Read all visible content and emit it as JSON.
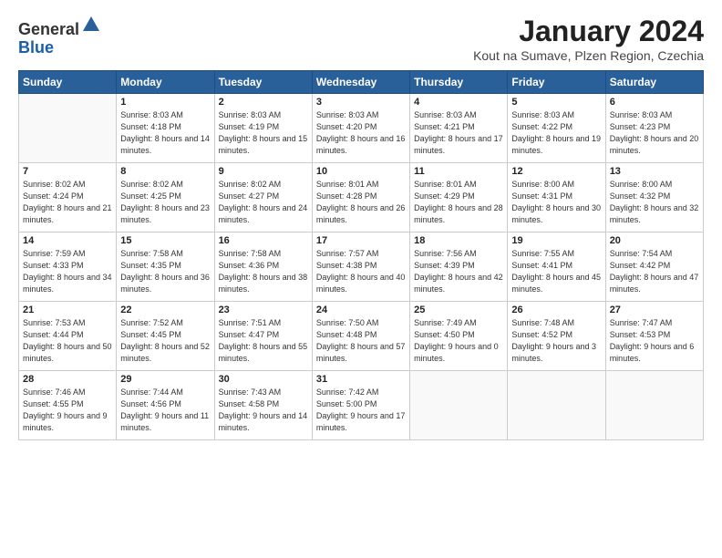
{
  "logo": {
    "general": "General",
    "blue": "Blue"
  },
  "title": "January 2024",
  "subtitle": "Kout na Sumave, Plzen Region, Czechia",
  "days_of_week": [
    "Sunday",
    "Monday",
    "Tuesday",
    "Wednesday",
    "Thursday",
    "Friday",
    "Saturday"
  ],
  "weeks": [
    [
      {
        "day": "",
        "empty": true
      },
      {
        "day": "1",
        "sunrise": "8:03 AM",
        "sunset": "4:18 PM",
        "daylight": "8 hours and 14 minutes."
      },
      {
        "day": "2",
        "sunrise": "8:03 AM",
        "sunset": "4:19 PM",
        "daylight": "8 hours and 15 minutes."
      },
      {
        "day": "3",
        "sunrise": "8:03 AM",
        "sunset": "4:20 PM",
        "daylight": "8 hours and 16 minutes."
      },
      {
        "day": "4",
        "sunrise": "8:03 AM",
        "sunset": "4:21 PM",
        "daylight": "8 hours and 17 minutes."
      },
      {
        "day": "5",
        "sunrise": "8:03 AM",
        "sunset": "4:22 PM",
        "daylight": "8 hours and 19 minutes."
      },
      {
        "day": "6",
        "sunrise": "8:03 AM",
        "sunset": "4:23 PM",
        "daylight": "8 hours and 20 minutes."
      }
    ],
    [
      {
        "day": "7",
        "sunrise": "8:02 AM",
        "sunset": "4:24 PM",
        "daylight": "8 hours and 21 minutes."
      },
      {
        "day": "8",
        "sunrise": "8:02 AM",
        "sunset": "4:25 PM",
        "daylight": "8 hours and 23 minutes."
      },
      {
        "day": "9",
        "sunrise": "8:02 AM",
        "sunset": "4:27 PM",
        "daylight": "8 hours and 24 minutes."
      },
      {
        "day": "10",
        "sunrise": "8:01 AM",
        "sunset": "4:28 PM",
        "daylight": "8 hours and 26 minutes."
      },
      {
        "day": "11",
        "sunrise": "8:01 AM",
        "sunset": "4:29 PM",
        "daylight": "8 hours and 28 minutes."
      },
      {
        "day": "12",
        "sunrise": "8:00 AM",
        "sunset": "4:31 PM",
        "daylight": "8 hours and 30 minutes."
      },
      {
        "day": "13",
        "sunrise": "8:00 AM",
        "sunset": "4:32 PM",
        "daylight": "8 hours and 32 minutes."
      }
    ],
    [
      {
        "day": "14",
        "sunrise": "7:59 AM",
        "sunset": "4:33 PM",
        "daylight": "8 hours and 34 minutes."
      },
      {
        "day": "15",
        "sunrise": "7:58 AM",
        "sunset": "4:35 PM",
        "daylight": "8 hours and 36 minutes."
      },
      {
        "day": "16",
        "sunrise": "7:58 AM",
        "sunset": "4:36 PM",
        "daylight": "8 hours and 38 minutes."
      },
      {
        "day": "17",
        "sunrise": "7:57 AM",
        "sunset": "4:38 PM",
        "daylight": "8 hours and 40 minutes."
      },
      {
        "day": "18",
        "sunrise": "7:56 AM",
        "sunset": "4:39 PM",
        "daylight": "8 hours and 42 minutes."
      },
      {
        "day": "19",
        "sunrise": "7:55 AM",
        "sunset": "4:41 PM",
        "daylight": "8 hours and 45 minutes."
      },
      {
        "day": "20",
        "sunrise": "7:54 AM",
        "sunset": "4:42 PM",
        "daylight": "8 hours and 47 minutes."
      }
    ],
    [
      {
        "day": "21",
        "sunrise": "7:53 AM",
        "sunset": "4:44 PM",
        "daylight": "8 hours and 50 minutes."
      },
      {
        "day": "22",
        "sunrise": "7:52 AM",
        "sunset": "4:45 PM",
        "daylight": "8 hours and 52 minutes."
      },
      {
        "day": "23",
        "sunrise": "7:51 AM",
        "sunset": "4:47 PM",
        "daylight": "8 hours and 55 minutes."
      },
      {
        "day": "24",
        "sunrise": "7:50 AM",
        "sunset": "4:48 PM",
        "daylight": "8 hours and 57 minutes."
      },
      {
        "day": "25",
        "sunrise": "7:49 AM",
        "sunset": "4:50 PM",
        "daylight": "9 hours and 0 minutes."
      },
      {
        "day": "26",
        "sunrise": "7:48 AM",
        "sunset": "4:52 PM",
        "daylight": "9 hours and 3 minutes."
      },
      {
        "day": "27",
        "sunrise": "7:47 AM",
        "sunset": "4:53 PM",
        "daylight": "9 hours and 6 minutes."
      }
    ],
    [
      {
        "day": "28",
        "sunrise": "7:46 AM",
        "sunset": "4:55 PM",
        "daylight": "9 hours and 9 minutes."
      },
      {
        "day": "29",
        "sunrise": "7:44 AM",
        "sunset": "4:56 PM",
        "daylight": "9 hours and 11 minutes."
      },
      {
        "day": "30",
        "sunrise": "7:43 AM",
        "sunset": "4:58 PM",
        "daylight": "9 hours and 14 minutes."
      },
      {
        "day": "31",
        "sunrise": "7:42 AM",
        "sunset": "5:00 PM",
        "daylight": "9 hours and 17 minutes."
      },
      {
        "day": "",
        "empty": true
      },
      {
        "day": "",
        "empty": true
      },
      {
        "day": "",
        "empty": true
      }
    ]
  ]
}
